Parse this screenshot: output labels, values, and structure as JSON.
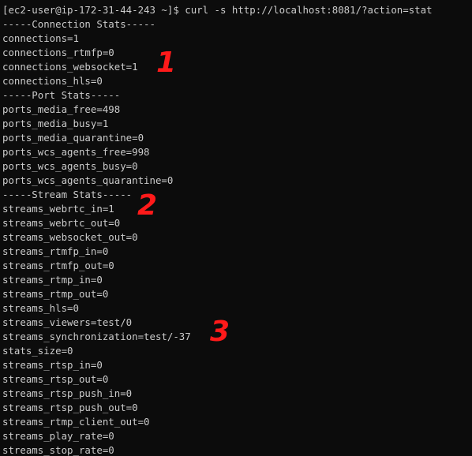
{
  "terminal": {
    "prompt": "[ec2-user@ip-172-31-44-243 ~]$ curl -s http://localhost:8081/?action=stat",
    "output": [
      "-----Connection Stats-----",
      "connections=1",
      "connections_rtmfp=0",
      "connections_websocket=1",
      "connections_hls=0",
      "-----Port Stats-----",
      "ports_media_free=498",
      "ports_media_busy=1",
      "ports_media_quarantine=0",
      "ports_wcs_agents_free=998",
      "ports_wcs_agents_busy=0",
      "ports_wcs_agents_quarantine=0",
      "-----Stream Stats-----",
      "streams_webrtc_in=1",
      "streams_webrtc_out=0",
      "streams_websocket_out=0",
      "streams_rtmfp_in=0",
      "streams_rtmfp_out=0",
      "streams_rtmp_in=0",
      "streams_rtmp_out=0",
      "streams_hls=0",
      "streams_viewers=test/0",
      "streams_synchronization=test/-37",
      "stats_size=0",
      "streams_rtsp_in=0",
      "streams_rtsp_out=0",
      "streams_rtsp_push_in=0",
      "streams_rtsp_push_out=0",
      "streams_rtmp_client_out=0",
      "streams_play_rate=0",
      "streams_stop_rate=0"
    ]
  },
  "annotations": {
    "marker_1": "1",
    "marker_2": "2",
    "marker_3": "3"
  },
  "colors": {
    "background": "#0c0c0c",
    "text": "#cccccc",
    "annotation": "#ff1a1a"
  }
}
